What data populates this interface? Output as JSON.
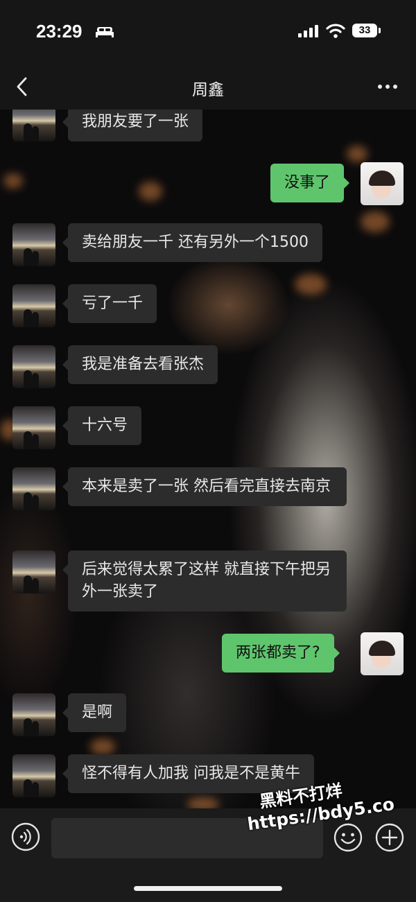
{
  "status": {
    "time": "23:29",
    "battery": "33"
  },
  "header": {
    "title": "周鑫"
  },
  "messages": [
    {
      "side": "in",
      "text": "我朋友要了一张"
    },
    {
      "side": "out",
      "text": "没事了"
    },
    {
      "side": "in",
      "text": "卖给朋友一千 还有另外一个1500"
    },
    {
      "side": "in",
      "text": "亏了一千"
    },
    {
      "side": "in",
      "text": "我是准备去看张杰"
    },
    {
      "side": "in",
      "text": "十六号"
    },
    {
      "side": "in",
      "text": "本来是卖了一张 然后看完直接去南京"
    },
    {
      "side": "in",
      "text": "后来觉得太累了这样 就直接下午把另外一张卖了"
    },
    {
      "side": "out",
      "text": "两张都卖了?"
    },
    {
      "side": "in",
      "text": "是啊"
    },
    {
      "side": "in",
      "text": "怪不得有人加我 问我是不是黄牛"
    }
  ],
  "watermark": {
    "line1": "黑料不打烊",
    "line2": "https://bdy5.co"
  },
  "colors": {
    "outgoing_bubble": "#5fc56d",
    "incoming_bubble": "#2c2c2c",
    "bar": "#161616"
  },
  "icons": [
    "bed-icon",
    "signal-icon",
    "wifi-icon",
    "back-icon",
    "more-icon",
    "voice-icon",
    "emoji-icon",
    "plus-icon"
  ]
}
